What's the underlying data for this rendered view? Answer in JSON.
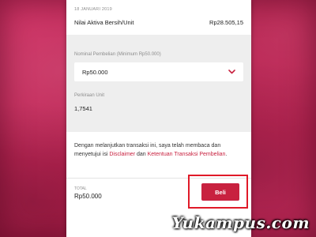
{
  "header": {
    "date": "18 JANUARI 2019",
    "nav_label": "Nilai Aktiva Bersih/Unit",
    "nav_value": "Rp28.505,15"
  },
  "purchase": {
    "nominal_label": "Nominal Pembelian (Minimum Rp50.000)",
    "nominal_selected": "Rp50.000",
    "estimate_label": "Perkiraan Unit",
    "estimate_value": "1,7541"
  },
  "disclaimer": {
    "text_before": "Dengan melanjutkan transaksi ini, saya telah membaca dan menyetujui isi ",
    "link1": "Disclaimer",
    "text_between": " dan ",
    "link2": "Ketentuan Transaksi Pembelian",
    "text_after": "."
  },
  "footer": {
    "total_label": "TOTAL",
    "total_value": "Rp50.000",
    "buy_label": "Beli"
  },
  "watermark": "Yukampus.com",
  "colors": {
    "accent": "#c8213f",
    "highlight": "#e01a28",
    "background": "#c2285a"
  },
  "icons": {
    "dropdown": "chevron-down-icon"
  }
}
